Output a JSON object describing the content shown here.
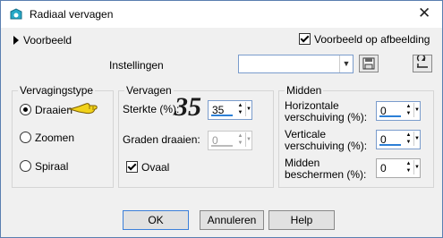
{
  "window": {
    "title": "Radiaal vervagen"
  },
  "preview": {
    "toggle_label": "Voorbeeld",
    "on_image_label": "Voorbeeld op afbeelding",
    "on_image_checked": true
  },
  "settings": {
    "label": "Instellingen",
    "value": ""
  },
  "blur_type": {
    "title": "Vervagingstype",
    "options": [
      {
        "label": "Draaien",
        "selected": true
      },
      {
        "label": "Zoomen",
        "selected": false
      },
      {
        "label": "Spiraal",
        "selected": false
      }
    ]
  },
  "blur": {
    "title": "Vervagen",
    "strength_label": "Sterkte (%):",
    "strength_annotation": "35",
    "strength_value": "35",
    "rotation_label": "Graden draaien:",
    "rotation_value": "0",
    "oval_label": "Ovaal",
    "oval_checked": true
  },
  "center": {
    "title": "Midden",
    "horizontal_label_1": "Horizontale",
    "horizontal_label_2": "verschuiving (%):",
    "horizontal_value": "0",
    "vertical_label_1": "Verticale",
    "vertical_label_2": "verschuiving (%):",
    "vertical_value": "0",
    "protect_label_1": "Midden",
    "protect_label_2": "beschermen (%):",
    "protect_value": "0"
  },
  "buttons": {
    "ok": "OK",
    "cancel": "Annuleren",
    "help": "Help"
  },
  "colors": {
    "accent": "#2c7fd6",
    "pointer_hand": "#f1d21a"
  }
}
